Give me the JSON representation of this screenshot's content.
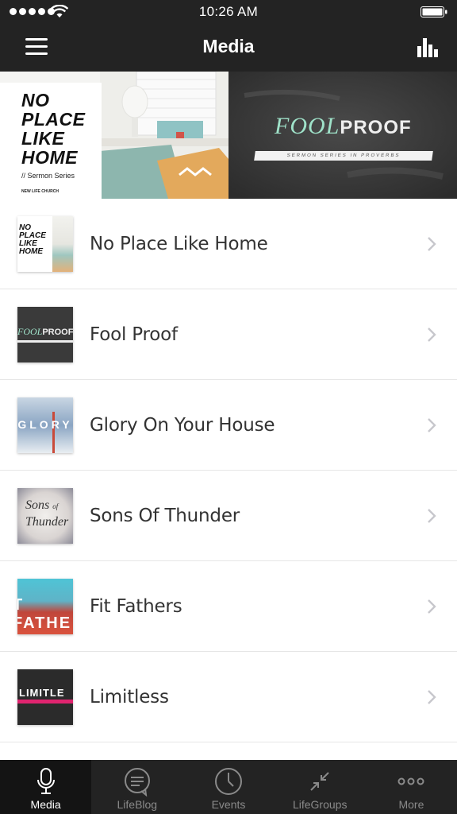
{
  "status_bar": {
    "time": "10:26 AM"
  },
  "header": {
    "title": "Media",
    "menu_icon": "hamburger-menu-icon",
    "stats_icon": "bar-chart-icon"
  },
  "hero": {
    "left": {
      "poster_title_lines": [
        "NO",
        "PLACE",
        "LIKE",
        "HOME"
      ],
      "poster_subtitle": "// Sermon Series",
      "poster_church": "NEW LIFE CHURCH"
    },
    "right": {
      "title_italic": "FOOL",
      "title_bold": "PROOF",
      "strip_text": "SERMON SERIES IN PROVERBS"
    }
  },
  "series": [
    {
      "title": "No Place Like Home",
      "thumb": "no-place-like-home"
    },
    {
      "title": "Fool Proof",
      "thumb": "fool-proof"
    },
    {
      "title": "Glory On Your House",
      "thumb": "glory-on-your-house"
    },
    {
      "title": "Sons Of Thunder",
      "thumb": "sons-of-thunder"
    },
    {
      "title": "Fit Fathers",
      "thumb": "fit-fathers"
    },
    {
      "title": "Limitless",
      "thumb": "limitless"
    }
  ],
  "thumbs": {
    "home_lines": [
      "NO",
      "PLACE",
      "LIKE",
      "HOME"
    ],
    "fool_italic": "FOOL",
    "fool_bold": "PROOF",
    "glory_text": "GLORY",
    "sons_line1": "Sons",
    "sons_of": "of",
    "sons_line2": "Thunder",
    "fit_text": "T FATHE",
    "lim_text": "LIMITLE"
  },
  "tabs": [
    {
      "label": "Media",
      "icon": "microphone-icon",
      "active": true
    },
    {
      "label": "LifeBlog",
      "icon": "chat-bubble-icon",
      "active": false
    },
    {
      "label": "Events",
      "icon": "clock-icon",
      "active": false
    },
    {
      "label": "LifeGroups",
      "icon": "arrows-inward-icon",
      "active": false
    },
    {
      "label": "More",
      "icon": "more-dots-icon",
      "active": false
    }
  ],
  "colors": {
    "bar_background": "#232323",
    "active_tab_background": "#141414",
    "row_text": "#333333",
    "chevron": "#c7c7cc"
  }
}
